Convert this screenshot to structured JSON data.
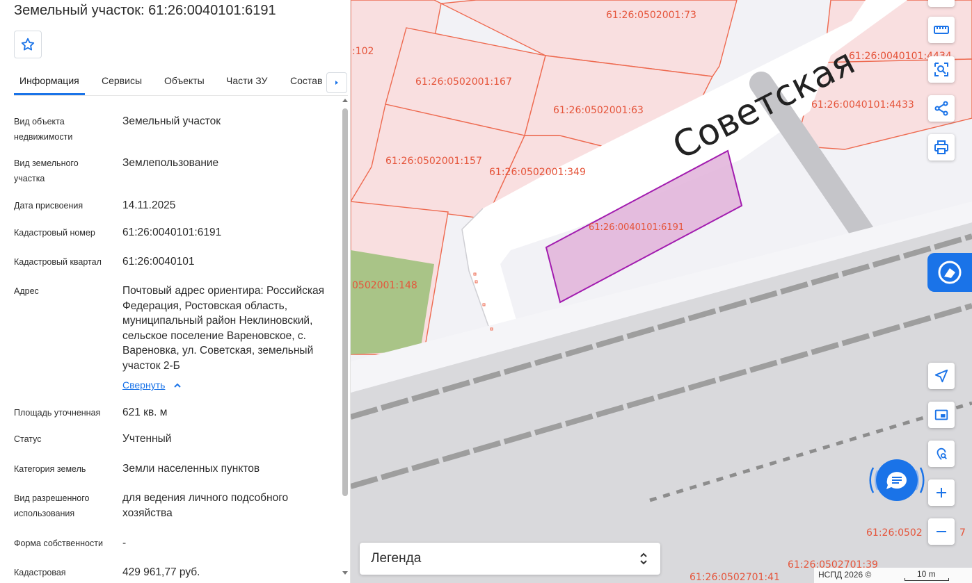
{
  "panel": {
    "title": "Земельный участок: 61:26:0040101:6191",
    "tabs": [
      "Информация",
      "Сервисы",
      "Объекты",
      "Части ЗУ",
      "Состав"
    ],
    "fields": [
      {
        "label": "Вид объекта недвижимости",
        "value": "Земельный участок"
      },
      {
        "label": "Вид земельного участка",
        "value": "Землепользование"
      },
      {
        "label": "Дата присвоения",
        "value": "14.11.2025"
      },
      {
        "label": "Кадастровый номер",
        "value": "61:26:0040101:6191"
      },
      {
        "label": "Кадастровый квартал",
        "value": "61:26:0040101"
      },
      {
        "label": "Адрес",
        "value": "Почтовый адрес ориентира: Российская Федерация, Ростовская область, муниципальный район Неклиновский, сельское поселение Вареновское, с. Вареновка, ул. Советская, земельный участок 2-Б"
      },
      {
        "label": "Площадь уточненная",
        "value": "621 кв. м"
      },
      {
        "label": "Статус",
        "value": "Учтенный"
      },
      {
        "label": "Категория земель",
        "value": "Земли населенных пунктов"
      },
      {
        "label": "Вид разрешенного использования",
        "value": "для ведения личного подсобного хозяйства"
      },
      {
        "label": "Форма собственности",
        "value": "-"
      },
      {
        "label": "Кадастровая",
        "value": "429 961,77 руб."
      }
    ],
    "collapse_label": "Свернуть"
  },
  "map": {
    "street_label": "Советская",
    "parcel_labels": [
      "61:26:0502001:73",
      ":102",
      "61:26:0040101:4434",
      "61:26:0502001:167",
      "61:26:0502001:63",
      "61:26:0040101:4433",
      "61:26:0502001:157",
      "61:26:0502001:349",
      "61:26:0040101:6191",
      "0502001:148",
      "61:26:0502",
      "61:26:0502701:39",
      "61:26:0502701:41",
      "7"
    ],
    "legend_label": "Легенда",
    "attribution": "НСПД 2026 ©",
    "scale_label": "10 m",
    "colors": {
      "parcel_fill": "#f9dfe0",
      "parcel_border": "#ee6a50",
      "selected_fill": "#e2b6dc",
      "selected_border": "#a21caf",
      "accent": "#1a73e8"
    }
  },
  "toolbar": {
    "icons": [
      "ruler-icon",
      "area-select-icon",
      "share-icon",
      "print-icon",
      "locate-icon",
      "minimap-icon",
      "geo-search-icon",
      "zoom-in-icon",
      "zoom-out-icon",
      "chat-icon"
    ]
  }
}
